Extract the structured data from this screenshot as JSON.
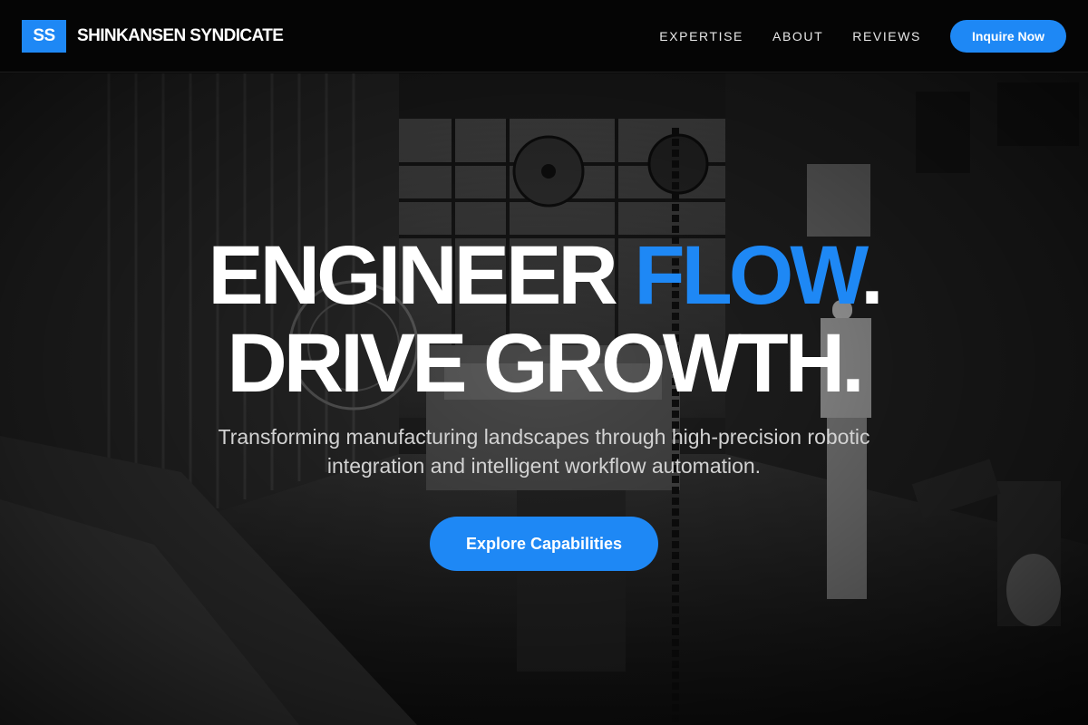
{
  "brand": {
    "logo_initials": "SS",
    "name": "SHINKANSEN SYNDICATE"
  },
  "nav": {
    "items": [
      {
        "label": "EXPERTISE"
      },
      {
        "label": "ABOUT"
      },
      {
        "label": "REVIEWS"
      }
    ],
    "cta_label": "Inquire Now"
  },
  "hero": {
    "headline_line1_part1": "ENGINEER ",
    "headline_line1_accent": "FLOW",
    "headline_line1_part2": ".",
    "headline_line2": "DRIVE GROWTH.",
    "subtitle": "Transforming manufacturing landscapes through high-precision robotic integration and intelligent workflow automation.",
    "cta_label": "Explore Capabilities",
    "background_image": "industrial-workshop-photo"
  },
  "colors": {
    "accent": "#1e88f5",
    "header_bg": "#050505",
    "text": "#ffffff",
    "subtitle": "#d2d2d2"
  }
}
